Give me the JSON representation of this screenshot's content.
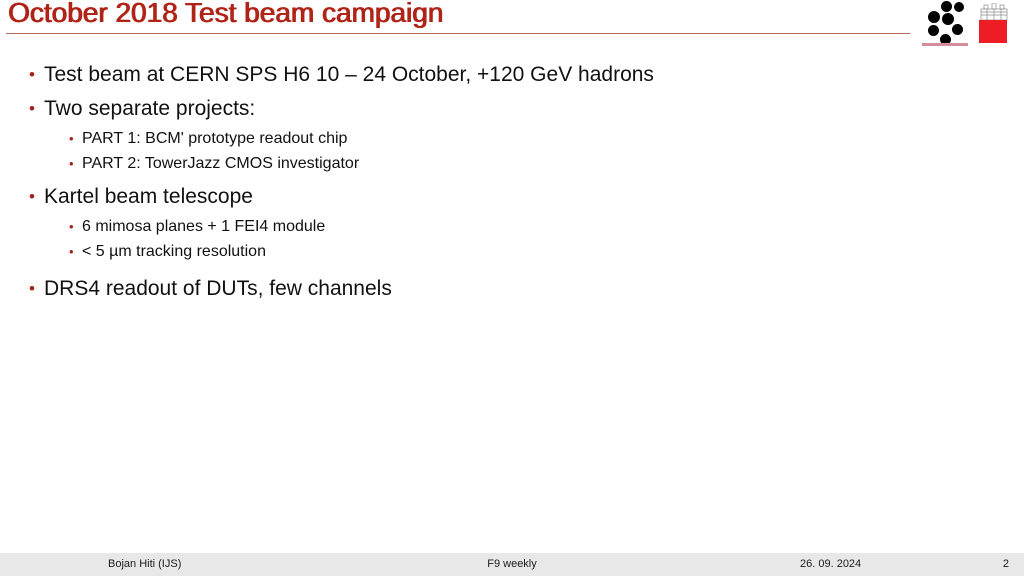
{
  "slide": {
    "title": "October 2018 Test beam campaign",
    "accent_color": "#b02418",
    "rule_color": "#b4685e",
    "bullet_color": "#a62019",
    "text_color": "#111111",
    "background_color": "#ffffff"
  },
  "logos": {
    "institute_logo_name": "ijs-logo",
    "university_logo_name": "university-ljubljana-logo",
    "university_logo_color": "#ee1c25"
  },
  "content": {
    "bullets": [
      {
        "level": 1,
        "text": "Test beam at CERN SPS H6 10 – 24 October, +120 GeV hadrons"
      },
      {
        "level": 1,
        "text": "Two separate projects:"
      },
      {
        "level": 2,
        "text": "PART 1: BCM' prototype readout chip"
      },
      {
        "level": 2,
        "text": "PART 2: TowerJazz CMOS investigator"
      },
      {
        "level": 1,
        "text": "Kartel beam telescope"
      },
      {
        "level": 2,
        "text": "6 mimosa planes + 1 FEI4 module"
      },
      {
        "level": 2,
        "text": "< 5 µm tracking resolution"
      },
      {
        "level": 1,
        "text": "DRS4 readout of DUTs, few channels"
      }
    ],
    "bullet_glyph": "•"
  },
  "footer": {
    "author": "Bojan Hiti (IJS)",
    "event": "F9 weekly",
    "date": "26. 09. 2024",
    "page_number": "2",
    "background_color": "#e8e8e8"
  }
}
